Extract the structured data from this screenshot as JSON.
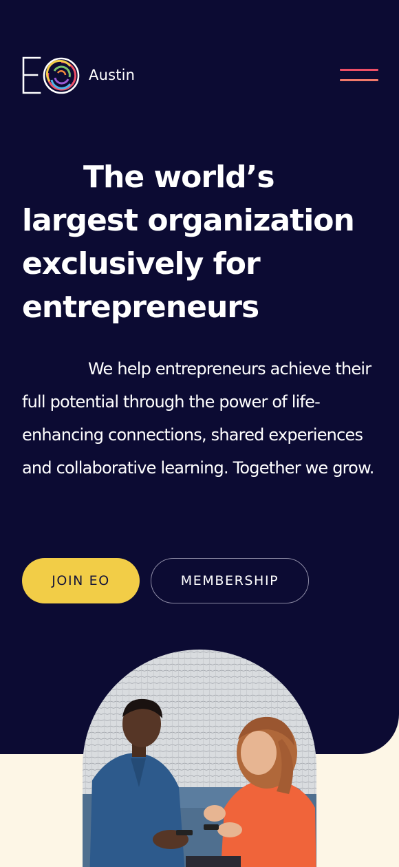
{
  "header": {
    "logo_mark": "EO",
    "city": "Austin",
    "menu_icon": "hamburger-menu-icon"
  },
  "hero": {
    "headline": "The world’s largest  organization exclusively for entrepreneurs",
    "intro": "We help entrepreneurs achieve their full potential through the power of life-enhancing connections, shared experiences and collaborative learning. Together we grow.",
    "buttons": {
      "join": "JOIN EO",
      "membership": "MEMBERSHIP"
    }
  },
  "colors": {
    "hero_background": "#0c0b33",
    "page_background": "#fdf6e6",
    "join_button": "#f2cd47",
    "menu_line_top": "#ed4f66",
    "menu_line_bottom": "#f17a6b"
  }
}
